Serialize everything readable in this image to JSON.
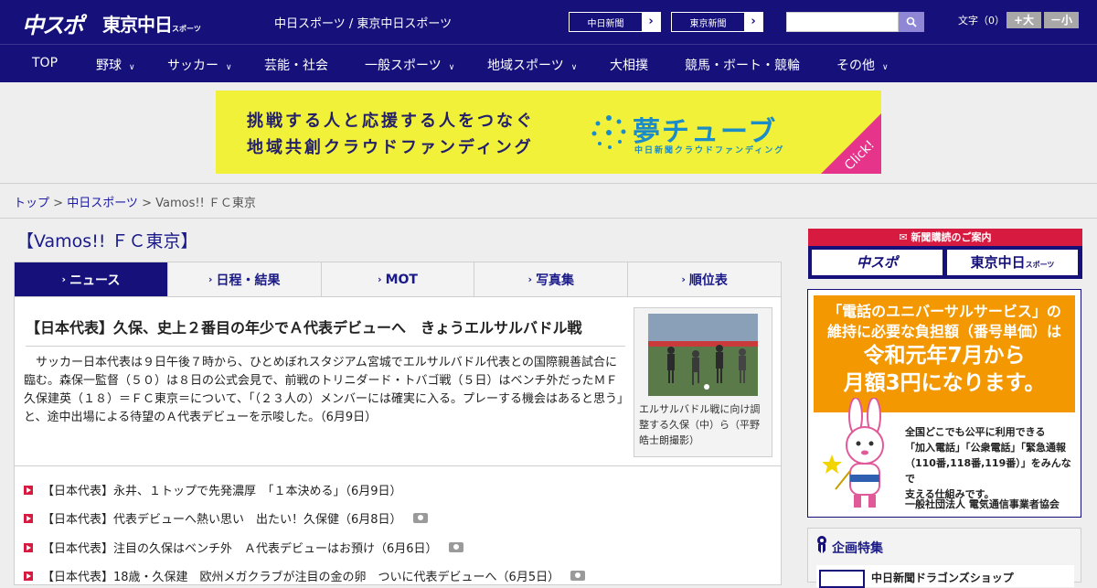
{
  "header": {
    "logo_chuspo": "中スポ",
    "logo_tokyo": "東京中日",
    "logo_tokyo_small": "スポーツ",
    "site_name": "中日スポーツ / 東京中日スポーツ",
    "ext_links": [
      {
        "label": "中日新聞",
        "arrow": "›"
      },
      {
        "label": "東京新聞",
        "arrow": "›"
      }
    ],
    "search_placeholder": "",
    "font_size_label": "文字（0）",
    "font_bigger": "+大",
    "font_smaller": "－小"
  },
  "gnav": [
    {
      "label": "TOP",
      "has_menu": false
    },
    {
      "label": "野球",
      "has_menu": true
    },
    {
      "label": "サッカー",
      "has_menu": true
    },
    {
      "label": "芸能・社会",
      "has_menu": false
    },
    {
      "label": "一般スポーツ",
      "has_menu": true
    },
    {
      "label": "地域スポーツ",
      "has_menu": true
    },
    {
      "label": "大相撲",
      "has_menu": false
    },
    {
      "label": "競馬・ボート・競輪",
      "has_menu": false
    },
    {
      "label": "その他",
      "has_menu": true
    }
  ],
  "banner": {
    "line1": "挑戦する人と応援する人をつなぐ",
    "line2": "地域共創クラウドファンディング",
    "brand": "夢チューブ",
    "sub": "中日新聞クラウドファンディング",
    "click": "Click!"
  },
  "breadcrumb": {
    "home": "トップ",
    "sep1": " > ",
    "section": "中日スポーツ",
    "sep2": " > ",
    "current": "Vamos!! ＦＣ東京"
  },
  "page_title": "【Vamos!! ＦＣ東京】",
  "tabs": [
    {
      "label": "ニュース",
      "active": true
    },
    {
      "label": "日程・結果",
      "active": false
    },
    {
      "label": "MOT",
      "active": false
    },
    {
      "label": "写真集",
      "active": false
    },
    {
      "label": "順位表",
      "active": false
    }
  ],
  "article": {
    "headline": "【日本代表】久保、史上２番目の年少でＡ代表デビューへ　きょうエルサルバドル戦",
    "body": "サッカー日本代表は９日午後７時から、ひとめぼれスタジアム宮城でエルサルバドル代表との国際親善試合に臨む。森保一監督（５０）は８日の公式会見で、前戦のトリニダード・トバゴ戦（５日）はベンチ外だったＭＦ久保建英（１８）＝ＦＣ東京＝について、「（２３人の）メンバーには確実に入る。プレーする機会はあると思う」と、途中出場による待望のＡ代表デビューを示唆した。（6月9日）",
    "photo_caption": "エルサルバドル戦に向け調整する久保（中）ら（平野皓士朗撮影）"
  },
  "related": [
    {
      "text": "【日本代表】永井、１トップで先発濃厚　「１本決める」（6月9日）",
      "camera": false
    },
    {
      "text": "【日本代表】代表デビューへ熱い思い　出たい！久保健（6月8日）",
      "camera": true
    },
    {
      "text": "【日本代表】注目の久保はベンチ外　Ａ代表デビューはお預け（6月6日）",
      "camera": true
    },
    {
      "text": "【日本代表】18歳・久保建　欧州メガクラブが注目の金の卵　ついに代表デビューへ（6月5日）",
      "camera": true
    }
  ],
  "sidebar": {
    "subscribe_head": "新聞購読のご案内",
    "sub_chuspo": "中スポ",
    "sub_tokyo": "東京中日",
    "sub_tokyo_small": "スポーツ",
    "ad_line1": "「電話のユニバーサルサービス」の",
    "ad_line2": "維持に必要な負担額（番号単価）は",
    "ad_big1": "令和元年7月から",
    "ad_big2": "月額3円になります。",
    "ad_t1": "全国どこでも公平に利用できる",
    "ad_t2": "「加入電話」「公衆電話」「緊急通報",
    "ad_t3": "（110番,118番,119番）」をみんなで",
    "ad_t4": "支える仕組みです。",
    "ad_org": "一般社団法人 電気通信事業者協会",
    "feature_title": "企画特集",
    "feature_item": "中日新聞ドラゴンズショップ"
  },
  "colors": {
    "navy": "#15107a",
    "red": "#d71a3f",
    "banner_yellow": "#f1f13a",
    "ad_orange": "#f39800"
  }
}
